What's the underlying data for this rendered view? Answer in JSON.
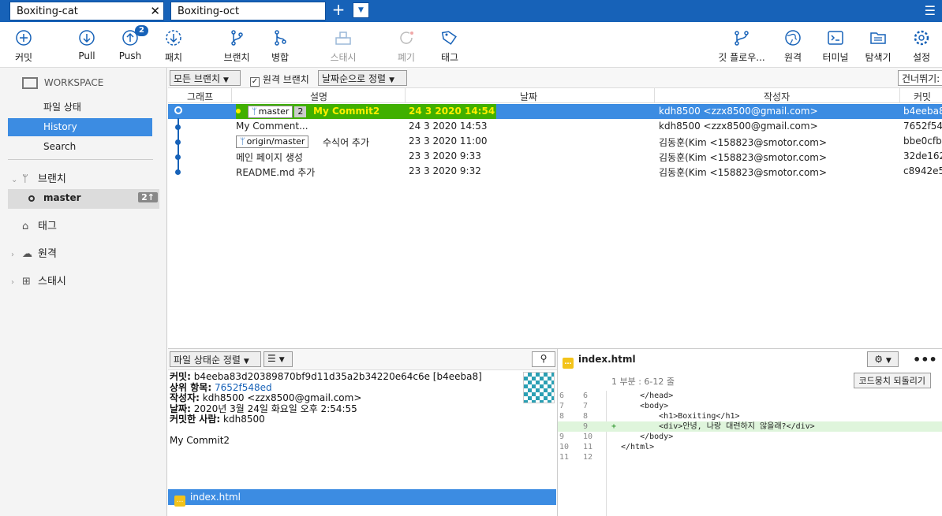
{
  "tabs": [
    {
      "label": "Boxiting-cat"
    },
    {
      "label": "Boxiting-oct"
    }
  ],
  "toolbar": {
    "commit": "커밋",
    "pull": "Pull",
    "push": "Push",
    "push_badge": "2",
    "fetch": "패치",
    "branch": "브랜치",
    "merge": "병합",
    "stash": "스태시",
    "discard": "폐기",
    "tag": "태그",
    "git_flow": "깃 플로우...",
    "remote": "원격",
    "terminal": "터미널",
    "explorer": "탐색기",
    "settings": "설정"
  },
  "sidebar": {
    "workspace": "WORKSPACE",
    "items": [
      {
        "label": "파일 상태"
      },
      {
        "label": "History"
      },
      {
        "label": "Search"
      }
    ],
    "branches_label": "브랜치",
    "branch": {
      "name": "master",
      "count": "2↑"
    },
    "tags_label": "태그",
    "remotes_label": "원격",
    "stashes_label": "스태시"
  },
  "filter": {
    "all_branches": "모든 브랜치",
    "remote_branches": "원격 브랜치",
    "sort_by_date": "날짜순으로 정렬",
    "jump_to": "건너뛰기:"
  },
  "columns": {
    "graph": "그래프",
    "description": "설명",
    "date": "날짜",
    "author": "작성자",
    "commit": "커밋"
  },
  "commits": [
    {
      "desc": "My Commit2",
      "branch_tag": "master",
      "ahead": "2",
      "date": "24 3 2020 14:54",
      "author": "kdh8500 <zzx8500@gmail.com>",
      "hash": "b4eeba8"
    },
    {
      "desc": "My Comment...",
      "date": "24 3 2020 14:53",
      "author": "kdh8500 <zzx8500@gmail.com>",
      "hash": "7652f54"
    },
    {
      "desc": "수식어 추가",
      "branch_tag": "origin/master",
      "date": "23 3 2020 11:00",
      "author": "김동훈(Kim <158823@smotor.com>",
      "hash": "bbe0cfb"
    },
    {
      "desc": "메인 페이지 생성",
      "date": "23 3 2020 9:33",
      "author": "김동훈(Kim <158823@smotor.com>",
      "hash": "32de162"
    },
    {
      "desc": "README.md 추가",
      "date": "23 3 2020 9:32",
      "author": "김동훈(Kim <158823@smotor.com>",
      "hash": "c8942e5"
    }
  ],
  "details": {
    "sort_label": "파일 상태순 정렬",
    "commit_label": "커밋:",
    "commit_value": "b4eeba83d20389870bf9d11d35a2b34220e64c6e [b4eeba8]",
    "parent_label": "상위 항목:",
    "parent_value": "7652f548ed",
    "author_label": "작성자:",
    "author_value": "kdh8500 <zzx8500@gmail.com>",
    "date_label": "날짜:",
    "date_value": "2020년 3월 24일 화요일 오후 2:54:55",
    "committer_label": "커밋한 사람:",
    "committer_value": "kdh8500",
    "message": "My Commit2",
    "file": "index.html"
  },
  "diff": {
    "file": "index.html",
    "hunk_title": "1 부분 : 6-12 줄",
    "revert_label": "코드뭉치 되돌리기",
    "lines": [
      {
        "old": "6",
        "new": "6",
        "mark": "",
        "code": "    </head>"
      },
      {
        "old": "7",
        "new": "7",
        "mark": "",
        "code": "    <body>"
      },
      {
        "old": "8",
        "new": "8",
        "mark": "",
        "code": "        <h1>Boxiting</h1>"
      },
      {
        "old": "",
        "new": "9",
        "mark": "+",
        "code": "        <div>안녕, 나랑 대련하지 않을래?</div>"
      },
      {
        "old": "9",
        "new": "10",
        "mark": "",
        "code": "    </body>"
      },
      {
        "old": "10",
        "new": "11",
        "mark": "",
        "code": "</html>"
      },
      {
        "old": "11",
        "new": "12",
        "mark": "",
        "code": ""
      }
    ]
  }
}
